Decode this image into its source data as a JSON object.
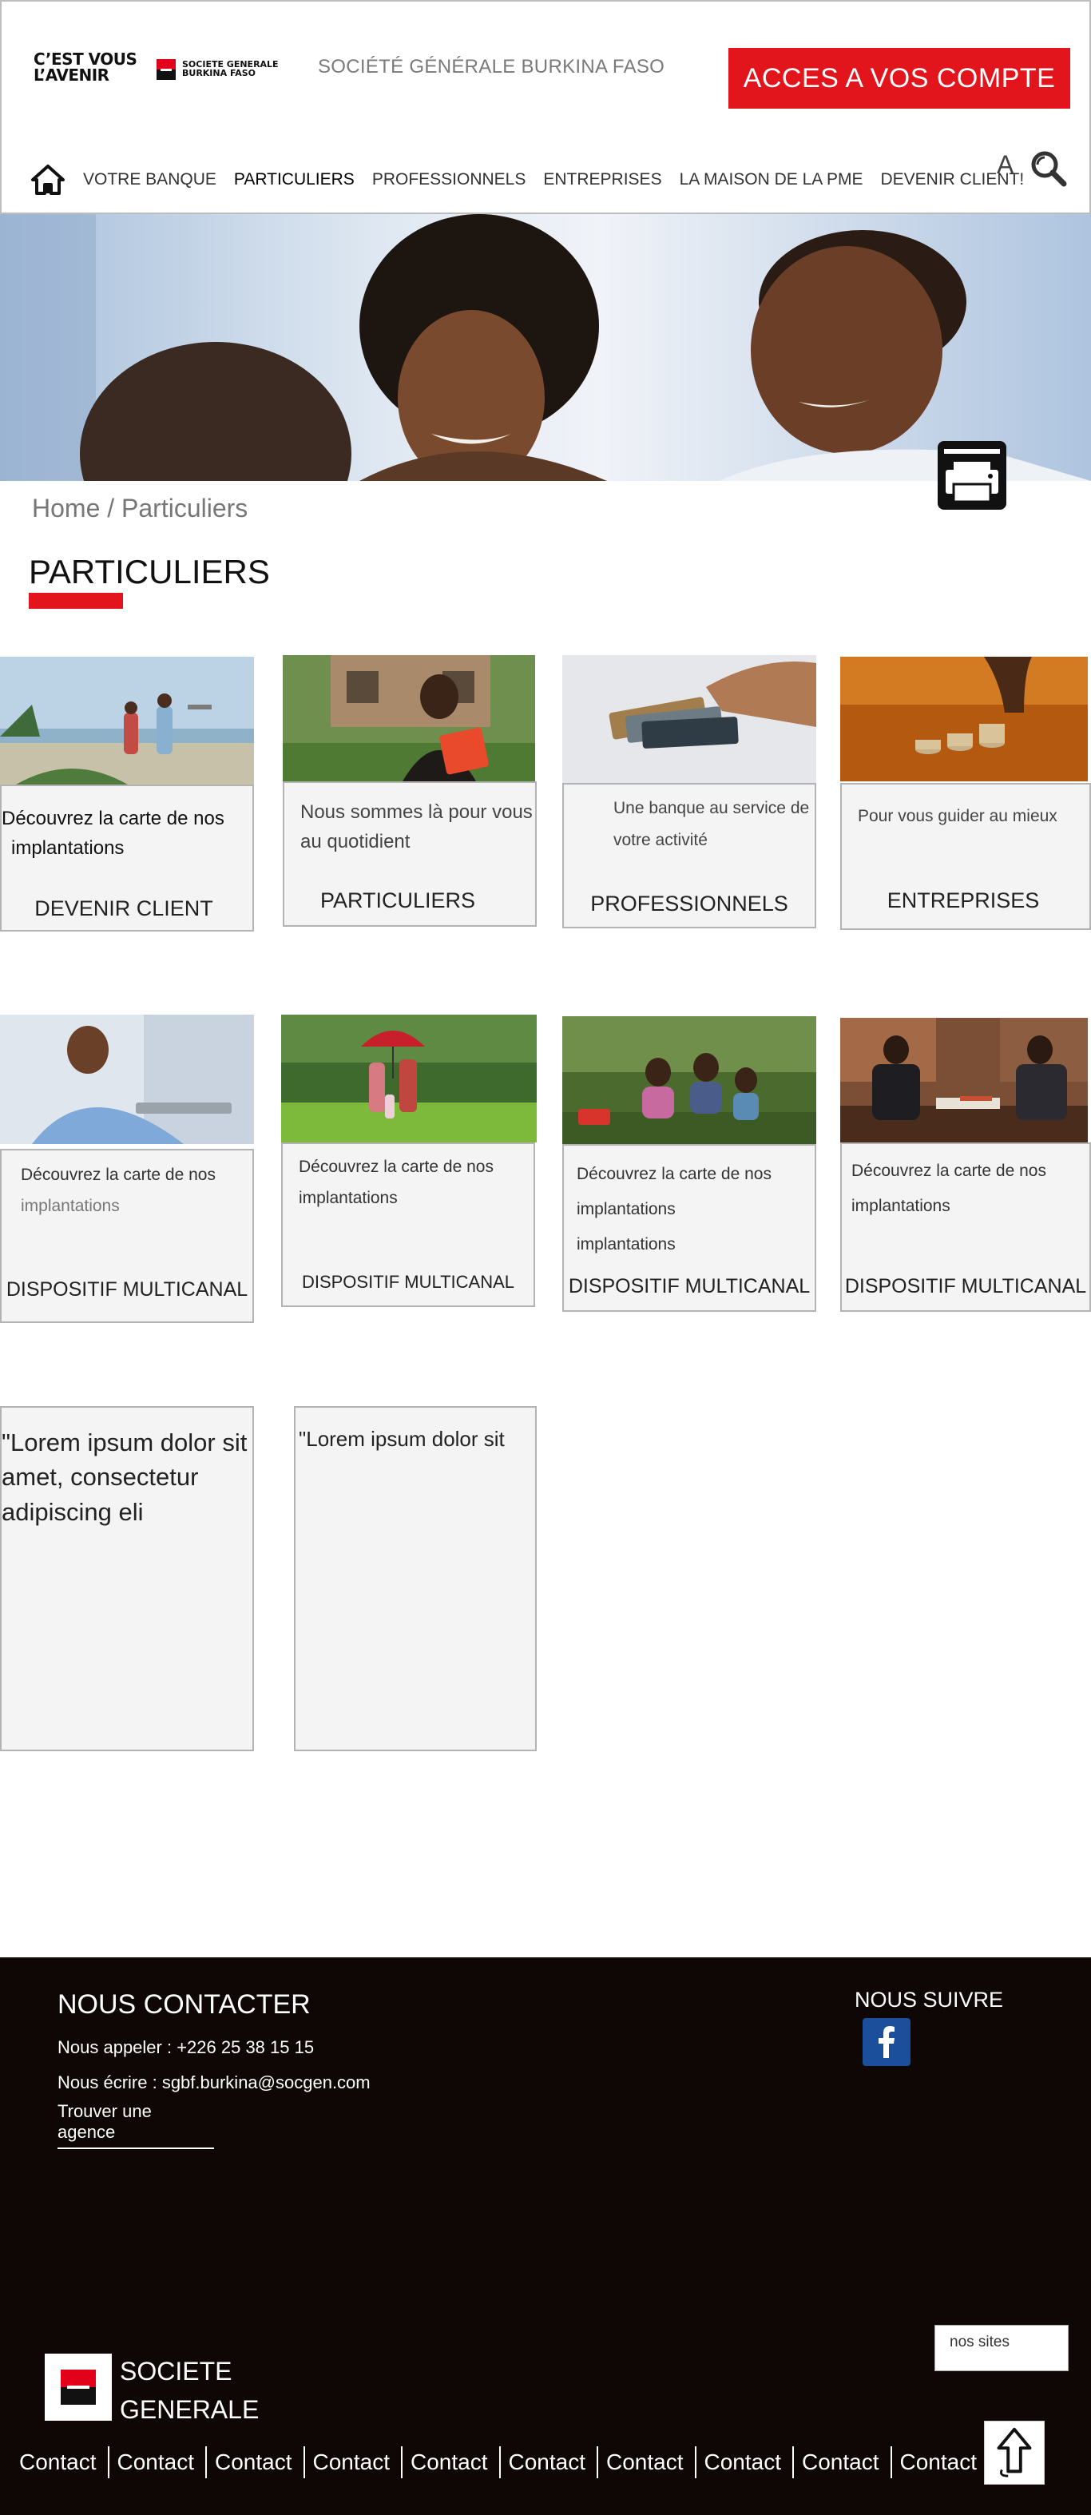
{
  "header": {
    "logo_slogan": [
      "C’EST VOUS",
      "L’AVENIR"
    ],
    "logo_name": [
      "SOCIETE GENERALE",
      "BURKINA FASO"
    ],
    "site_title": "SOCIÉTÉ GÉNÉRALE BURKINA FASO",
    "access_button": "ACCES A VOS COMPTE",
    "font_size_toggle": "A"
  },
  "nav": {
    "items": [
      "VOTRE BANQUE",
      "PARTICULIERS",
      "PROFESSIONNELS",
      "ENTREPRISES",
      "LA MAISON DE LA PME",
      "DEVENIR CLIENT!"
    ],
    "active": "PARTICULIERS"
  },
  "breadcrumb": "Home / Particuliers",
  "page_title": "PARTICULIERS",
  "cards_row1": [
    {
      "desc_lines": [
        "Découvrez la carte de nos",
        " implantations"
      ],
      "label": "DEVENIR CLIENT",
      "image": "people-beach"
    },
    {
      "desc_lines": [
        "Nous sommes là pour vous",
        "au quotidient"
      ],
      "label": "PARTICULIERS",
      "image": "woman-folder"
    },
    {
      "desc_lines": [
        "Une banque au service de",
        "votre activité"
      ],
      "label": "PROFESSIONNELS",
      "image": "hand-cards"
    },
    {
      "desc_lines": [
        "Pour vous guider au mieux"
      ],
      "label": "ENTREPRISES",
      "image": "coins-stack"
    }
  ],
  "cards_row2": [
    {
      "desc_lines": [
        "Découvrez la carte de nos",
        "implantations"
      ],
      "label": "DISPOSITIF MULTICANAL",
      "image": "man-laptop"
    },
    {
      "desc_lines": [
        "Découvrez la carte de nos",
        "implantations"
      ],
      "label": "DISPOSITIF MULTICANAL",
      "image": "family-umbrella"
    },
    {
      "desc_lines": [
        "Découvrez la carte de nos",
        "implantations",
        "implantations"
      ],
      "label": "DISPOSITIF MULTICANAL",
      "image": "family-garden"
    },
    {
      "desc_lines": [
        "Découvrez la carte de nos",
        " implantations"
      ],
      "label": "DISPOSITIF MULTICANAL",
      "image": "office-meeting"
    }
  ],
  "lorem_cards": [
    "\"Lorem ipsum dolor sit amet, consectetur adipiscing eli",
    "\"Lorem ipsum dolor sit"
  ],
  "footer": {
    "contact_title": "NOUS CONTACTER",
    "phone": "Nous appeler : +226 25 38 15 15",
    "email": "Nous écrire : sgbf.burkina@socgen.com",
    "find_agency": "Trouver une agence",
    "follow_title": "NOUS SUIVRE",
    "sites_select": "nos sites",
    "brand": [
      "SOCIETE",
      "GENERALE"
    ],
    "contacts": [
      "Contact",
      "Contact",
      "Contact",
      "Contact",
      "Contact",
      "Contact",
      "Contact",
      "Contact",
      "Contact",
      "Contact"
    ]
  },
  "colors": {
    "accent_red": "#e3151c",
    "footer_bg": "#0f0606",
    "card_bg": "#f4f4f4",
    "facebook_blue": "#1b4f9c"
  }
}
